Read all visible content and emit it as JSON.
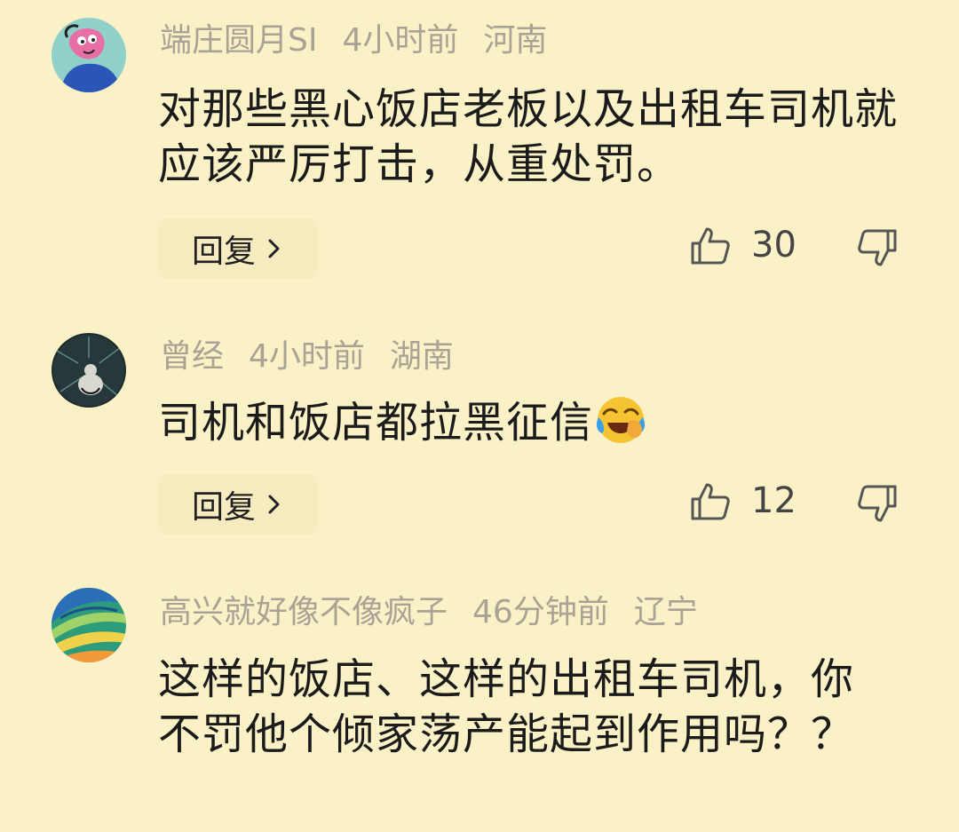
{
  "comments": [
    {
      "user": "端庄圆月SI",
      "time": "4小时前",
      "location": "河南",
      "text": "对那些黑心饭店老板以及出租车司机就应该严厉打击，从重处罚。",
      "reply_label": "回复",
      "likes": "30"
    },
    {
      "user": "曾经",
      "time": "4小时前",
      "location": "湖南",
      "text": "司机和饭店都拉黑征信",
      "emoji": "laughing-crying-emoji",
      "reply_label": "回复",
      "likes": "12"
    },
    {
      "user": "高兴就好像不像疯子",
      "time": "46分钟前",
      "location": "辽宁",
      "text": "这样的饭店、这样的出租车司机，你不罚他个倾家荡产能起到作用吗？？"
    }
  ],
  "icons": {
    "like": "thumbs-up-icon",
    "dislike": "thumbs-down-icon",
    "reply_chevron": "chevron-right-icon"
  },
  "colors": {
    "background": "#fbf1c7",
    "meta_text": "#a9a396",
    "body_text": "#1b1b1b",
    "reply_button_bg": "#f7ebc0"
  }
}
